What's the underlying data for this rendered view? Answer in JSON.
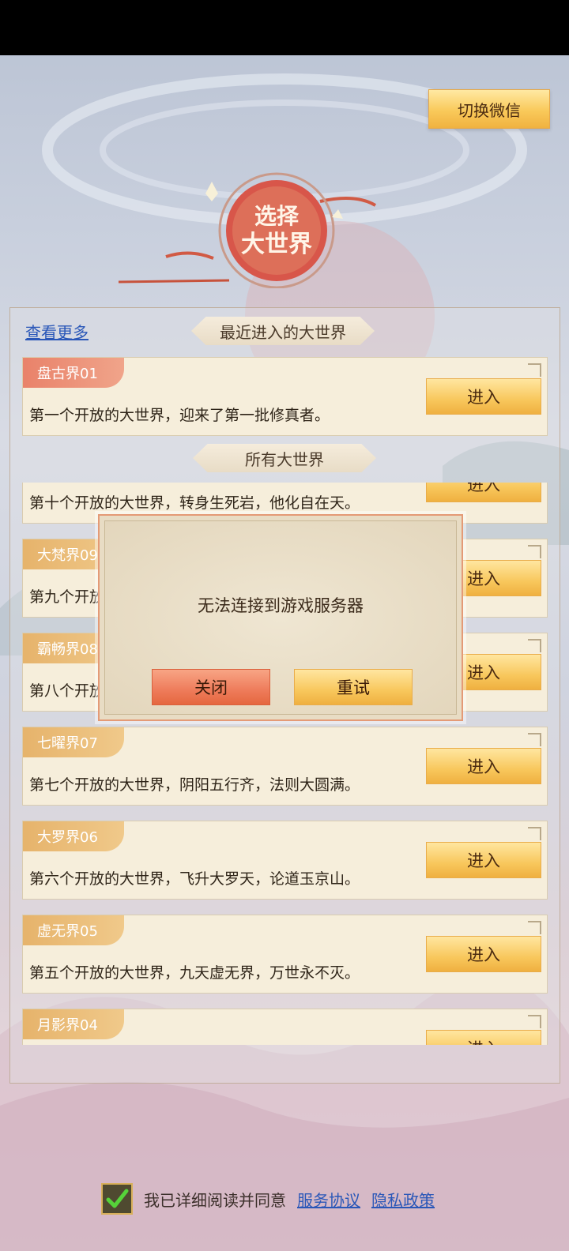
{
  "header": {
    "switch_label": "切换微信"
  },
  "emblem": {
    "line1": "选择",
    "line2": "大世界"
  },
  "recent": {
    "view_more": "查看更多",
    "title": "最近进入的大世界",
    "card": {
      "tag": "盘古界01",
      "desc": "第一个开放的大世界，迎来了第一批修真者。",
      "enter": "进入"
    }
  },
  "all": {
    "title": "所有大世界",
    "cards": [
      {
        "tag": "",
        "desc": "第十个开放的大世界，转身生死岩，他化自在天。",
        "enter": "进入"
      },
      {
        "tag": "大梵界09",
        "desc": "第九个开放",
        "enter": "进入"
      },
      {
        "tag": "霸畅界08",
        "desc": "第八个开放",
        "enter": "进入"
      },
      {
        "tag": "七曜界07",
        "desc": "第七个开放的大世界，阴阳五行齐，法则大圆满。",
        "enter": "进入"
      },
      {
        "tag": "大罗界06",
        "desc": "第六个开放的大世界，飞升大罗天，论道玉京山。",
        "enter": "进入"
      },
      {
        "tag": "虚无界05",
        "desc": "第五个开放的大世界，九天虚无界，万世永不灭。",
        "enter": "进入"
      },
      {
        "tag": "月影界04",
        "desc": "",
        "enter": "进入"
      }
    ]
  },
  "dialog": {
    "message": "无法连接到游戏服务器",
    "close": "关闭",
    "retry": "重试"
  },
  "agreement": {
    "text": "我已详细阅读并同意",
    "service": "服务协议",
    "privacy": "隐私政策",
    "checked": true
  }
}
